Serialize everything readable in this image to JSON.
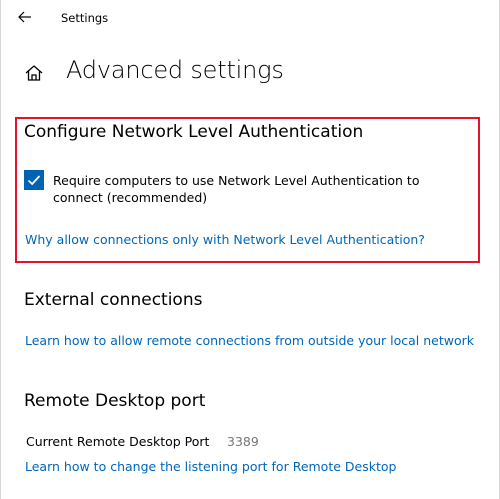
{
  "window": {
    "title": "Settings"
  },
  "page": {
    "title": "Advanced settings"
  },
  "nla_section": {
    "heading": "Configure Network Level Authentication",
    "checkbox_label": "Require computers to use Network Level Authentication to connect (recommended)",
    "checkbox_checked": true,
    "link": "Why allow connections only with Network Level Authentication?"
  },
  "external_section": {
    "heading": "External connections",
    "link": "Learn how to allow remote connections from outside your local network"
  },
  "port_section": {
    "heading": "Remote Desktop port",
    "port_label": "Current Remote Desktop Port",
    "port_value": "3389",
    "link": "Learn how to change the listening port for Remote Desktop"
  },
  "colors": {
    "accent": "#0063b1",
    "link": "#0067b8",
    "highlight_border": "#e8112d",
    "muted_text": "#767676"
  },
  "icons": {
    "back": "back-arrow-icon",
    "home": "home-icon",
    "check": "checkmark-icon"
  }
}
